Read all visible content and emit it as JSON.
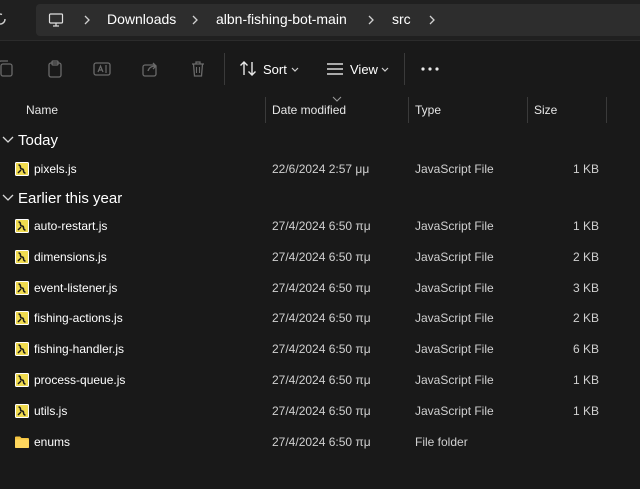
{
  "address": {
    "breadcrumbs": [
      "Downloads",
      "albn-fishing-bot-main",
      "src"
    ]
  },
  "toolbar": {
    "sort_label": "Sort",
    "view_label": "View"
  },
  "columns": {
    "name": "Name",
    "date": "Date modified",
    "type": "Type",
    "size": "Size"
  },
  "groups": [
    {
      "title": "Today",
      "items": [
        {
          "name": "pixels.js",
          "date": "22/6/2024 2:57 μμ",
          "type": "JavaScript File",
          "size": "1 KB",
          "icon": "js-file-icon"
        }
      ]
    },
    {
      "title": "Earlier this year",
      "items": [
        {
          "name": "auto-restart.js",
          "date": "27/4/2024 6:50 πμ",
          "type": "JavaScript File",
          "size": "1 KB",
          "icon": "js-file-icon"
        },
        {
          "name": "dimensions.js",
          "date": "27/4/2024 6:50 πμ",
          "type": "JavaScript File",
          "size": "2 KB",
          "icon": "js-file-icon"
        },
        {
          "name": "event-listener.js",
          "date": "27/4/2024 6:50 πμ",
          "type": "JavaScript File",
          "size": "3 KB",
          "icon": "js-file-icon"
        },
        {
          "name": "fishing-actions.js",
          "date": "27/4/2024 6:50 πμ",
          "type": "JavaScript File",
          "size": "2 KB",
          "icon": "js-file-icon"
        },
        {
          "name": "fishing-handler.js",
          "date": "27/4/2024 6:50 πμ",
          "type": "JavaScript File",
          "size": "6 KB",
          "icon": "js-file-icon"
        },
        {
          "name": "process-queue.js",
          "date": "27/4/2024 6:50 πμ",
          "type": "JavaScript File",
          "size": "1 KB",
          "icon": "js-file-icon"
        },
        {
          "name": "utils.js",
          "date": "27/4/2024 6:50 πμ",
          "type": "JavaScript File",
          "size": "1 KB",
          "icon": "js-file-icon"
        },
        {
          "name": "enums",
          "date": "27/4/2024 6:50 πμ",
          "type": "File folder",
          "size": "",
          "icon": "folder-icon"
        }
      ]
    }
  ],
  "colors": {
    "background": "#191919",
    "address_bar": "#202020",
    "breadcrumb_box": "#2d2d2d",
    "folder": "#f5c542",
    "js_icon": "#f0db4f"
  }
}
